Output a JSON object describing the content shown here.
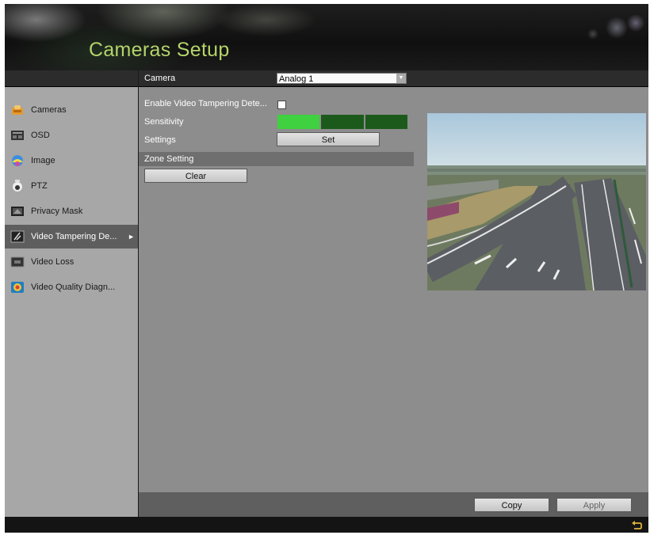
{
  "header": {
    "title": "Cameras Setup"
  },
  "sidebar": {
    "items": [
      {
        "label": "Cameras",
        "icon": "cameras-icon",
        "active": false
      },
      {
        "label": "OSD",
        "icon": "osd-icon",
        "active": false
      },
      {
        "label": "Image",
        "icon": "image-icon",
        "active": false
      },
      {
        "label": "PTZ",
        "icon": "ptz-icon",
        "active": false
      },
      {
        "label": "Privacy Mask",
        "icon": "privacy-mask-icon",
        "active": false
      },
      {
        "label": "Video Tampering De...",
        "icon": "video-tampering-icon",
        "active": true
      },
      {
        "label": "Video Loss",
        "icon": "video-loss-icon",
        "active": false
      },
      {
        "label": "Video Quality Diagn...",
        "icon": "video-quality-icon",
        "active": false
      }
    ]
  },
  "form": {
    "camera_label": "Camera",
    "camera_value": "Analog 1",
    "enable_label": "Enable Video Tampering Dete...",
    "enable_checked": false,
    "sensitivity_label": "Sensitivity",
    "sensitivity_level": 1,
    "sensitivity_max": 3,
    "settings_label": "Settings",
    "set_button": "Set",
    "zone_setting": "Zone Setting",
    "clear_button": "Clear"
  },
  "footer": {
    "copy_button": "Copy",
    "apply_button": "Apply"
  },
  "colors": {
    "accent_title": "#b5d36a",
    "sensitivity_on": "#3fd13f",
    "sensitivity_off": "#1c5a1c"
  }
}
